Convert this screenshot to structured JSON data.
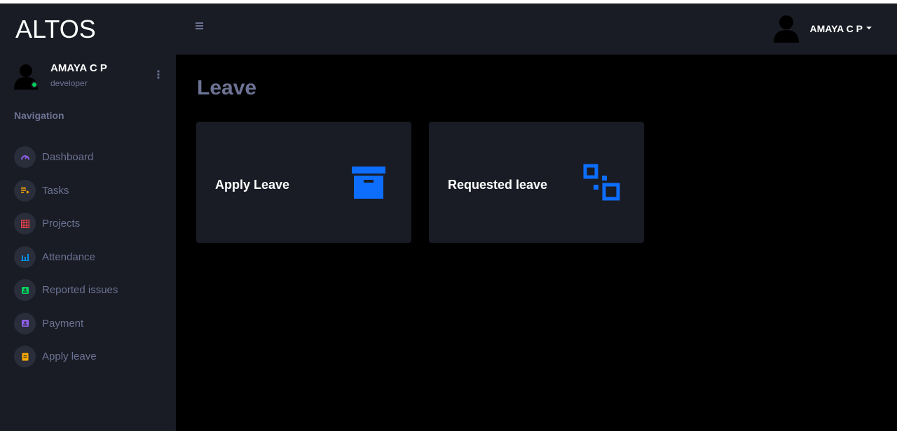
{
  "app": {
    "brand": "ALTOS"
  },
  "profile": {
    "name": "AMAYA C P",
    "role": "developer",
    "menu_icon": "more-vertical-icon"
  },
  "navigation": {
    "heading": "Navigation",
    "items": [
      {
        "label": "Dashboard",
        "icon": "speedometer-icon",
        "color": "#8f5fe8"
      },
      {
        "label": "Tasks",
        "icon": "playlist-play-icon",
        "color": "#ffab00"
      },
      {
        "label": "Projects",
        "icon": "table-large-icon",
        "color": "#fc424a"
      },
      {
        "label": "Attendance",
        "icon": "chart-bar-icon",
        "color": "#0090e7"
      },
      {
        "label": "Reported issues",
        "icon": "contacts-icon",
        "color": "#00d25b"
      },
      {
        "label": "Payment",
        "icon": "account-box-icon",
        "color": "#8f5fe8"
      },
      {
        "label": "Apply leave",
        "icon": "file-document-icon",
        "color": "#ffab00"
      }
    ]
  },
  "header": {
    "menu_icon": "hamburger-icon",
    "user_name": "AMAYA C P"
  },
  "main": {
    "title": "Leave",
    "cards": [
      {
        "label": "Apply Leave",
        "icon": "archive-icon",
        "icon_color": "#0d6efd"
      },
      {
        "label": "Requested leave",
        "icon": "flip-squares-icon",
        "icon_color": "#0d6efd"
      }
    ]
  },
  "colors": {
    "sidebar_bg": "#191c24",
    "main_bg": "#000000",
    "muted_text": "#6c7293",
    "online_status": "#00d25b"
  }
}
